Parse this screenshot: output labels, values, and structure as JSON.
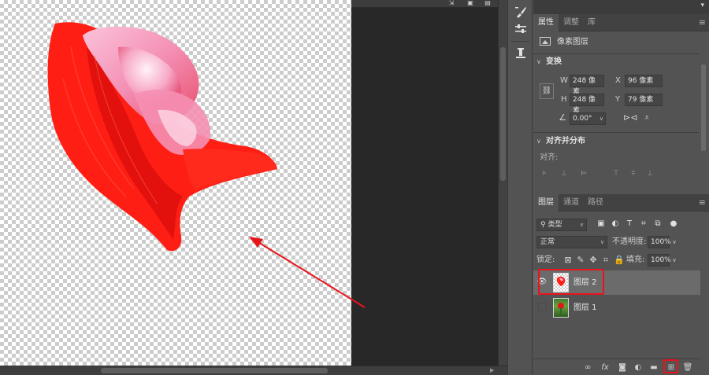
{
  "canvas": {
    "petal_colors": {
      "main": "#ff1a12",
      "dark": "#d40a0a",
      "pink": "#f59bbd",
      "light": "#fde0ee"
    }
  },
  "annotation": {
    "color": "#e8141b"
  },
  "toolstrip": {
    "tools": [
      {
        "name": "brush-settings-icon",
        "glyph": "🖌"
      },
      {
        "name": "adjust-sliders-icon",
        "glyph": "⚌"
      },
      {
        "name": "clone-source-icon",
        "glyph": "⍑"
      }
    ]
  },
  "properties": {
    "tabs": [
      "属性",
      "调整",
      "库"
    ],
    "layer_kind": "像素图层",
    "transform": {
      "title": "变换",
      "w_label": "W",
      "w_value": "248 像素",
      "x_label": "X",
      "x_value": "96 像素",
      "h_label": "H",
      "h_value": "248 像素",
      "y_label": "Y",
      "y_value": "79 像素",
      "angle_value": "0.00°"
    },
    "align": {
      "title": "对齐并分布",
      "label": "对齐:"
    }
  },
  "layers_panel": {
    "tabs": [
      "图层",
      "通道",
      "路径"
    ],
    "filter_kind": "类型",
    "blend_mode": "正常",
    "opacity_label": "不透明度:",
    "opacity_value": "100%",
    "lock_label": "锁定:",
    "fill_label": "填充:",
    "fill_value": "100%",
    "layers": [
      {
        "name": "图层 2",
        "selected": true,
        "visible": true
      },
      {
        "name": "图层 1",
        "selected": false,
        "visible": false
      }
    ]
  },
  "highlight_color": "#e8141b"
}
